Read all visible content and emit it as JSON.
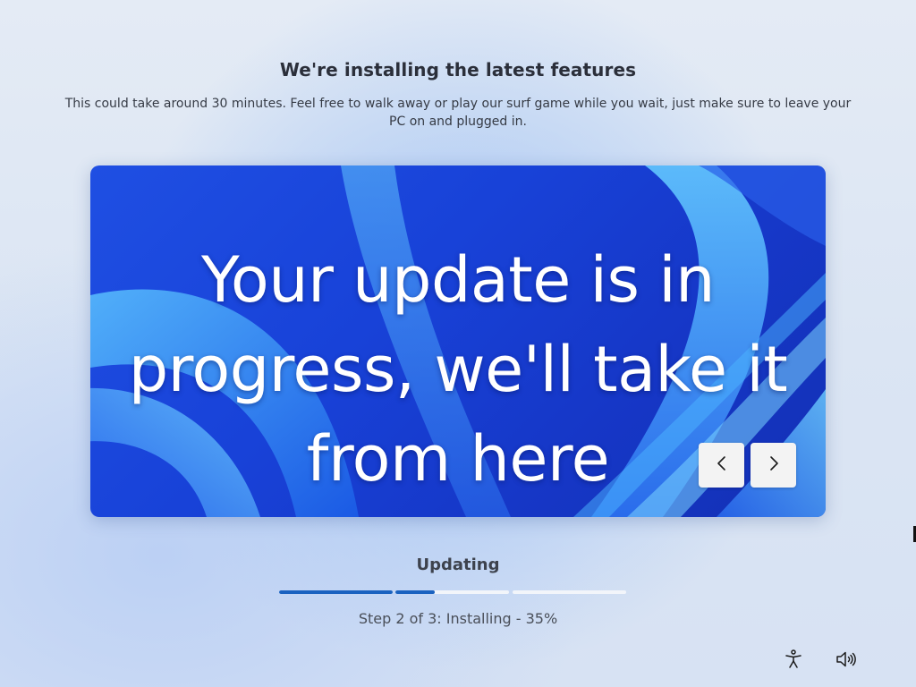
{
  "header": {
    "title": "We're installing the latest features",
    "subtitle": "This could take around 30 minutes. Feel free to walk away or play our surf game while you wait, just make sure to leave your PC on and plugged in."
  },
  "carousel": {
    "slide_text": "Your update is in progress, we'll take it from here",
    "prev_icon": "chevron-left-icon",
    "next_icon": "chevron-right-icon",
    "background_colors": [
      "#1f4fe3",
      "#1230b4",
      "#4db0f5"
    ]
  },
  "status": {
    "title": "Updating",
    "step_text": "Step 2 of 3: Installing - 35%",
    "total_steps": 3,
    "current_step": 2,
    "current_step_percent": 35,
    "accent_color": "#1a62c0"
  },
  "footer": {
    "accessibility_icon": "accessibility-icon",
    "volume_icon": "volume-icon"
  }
}
